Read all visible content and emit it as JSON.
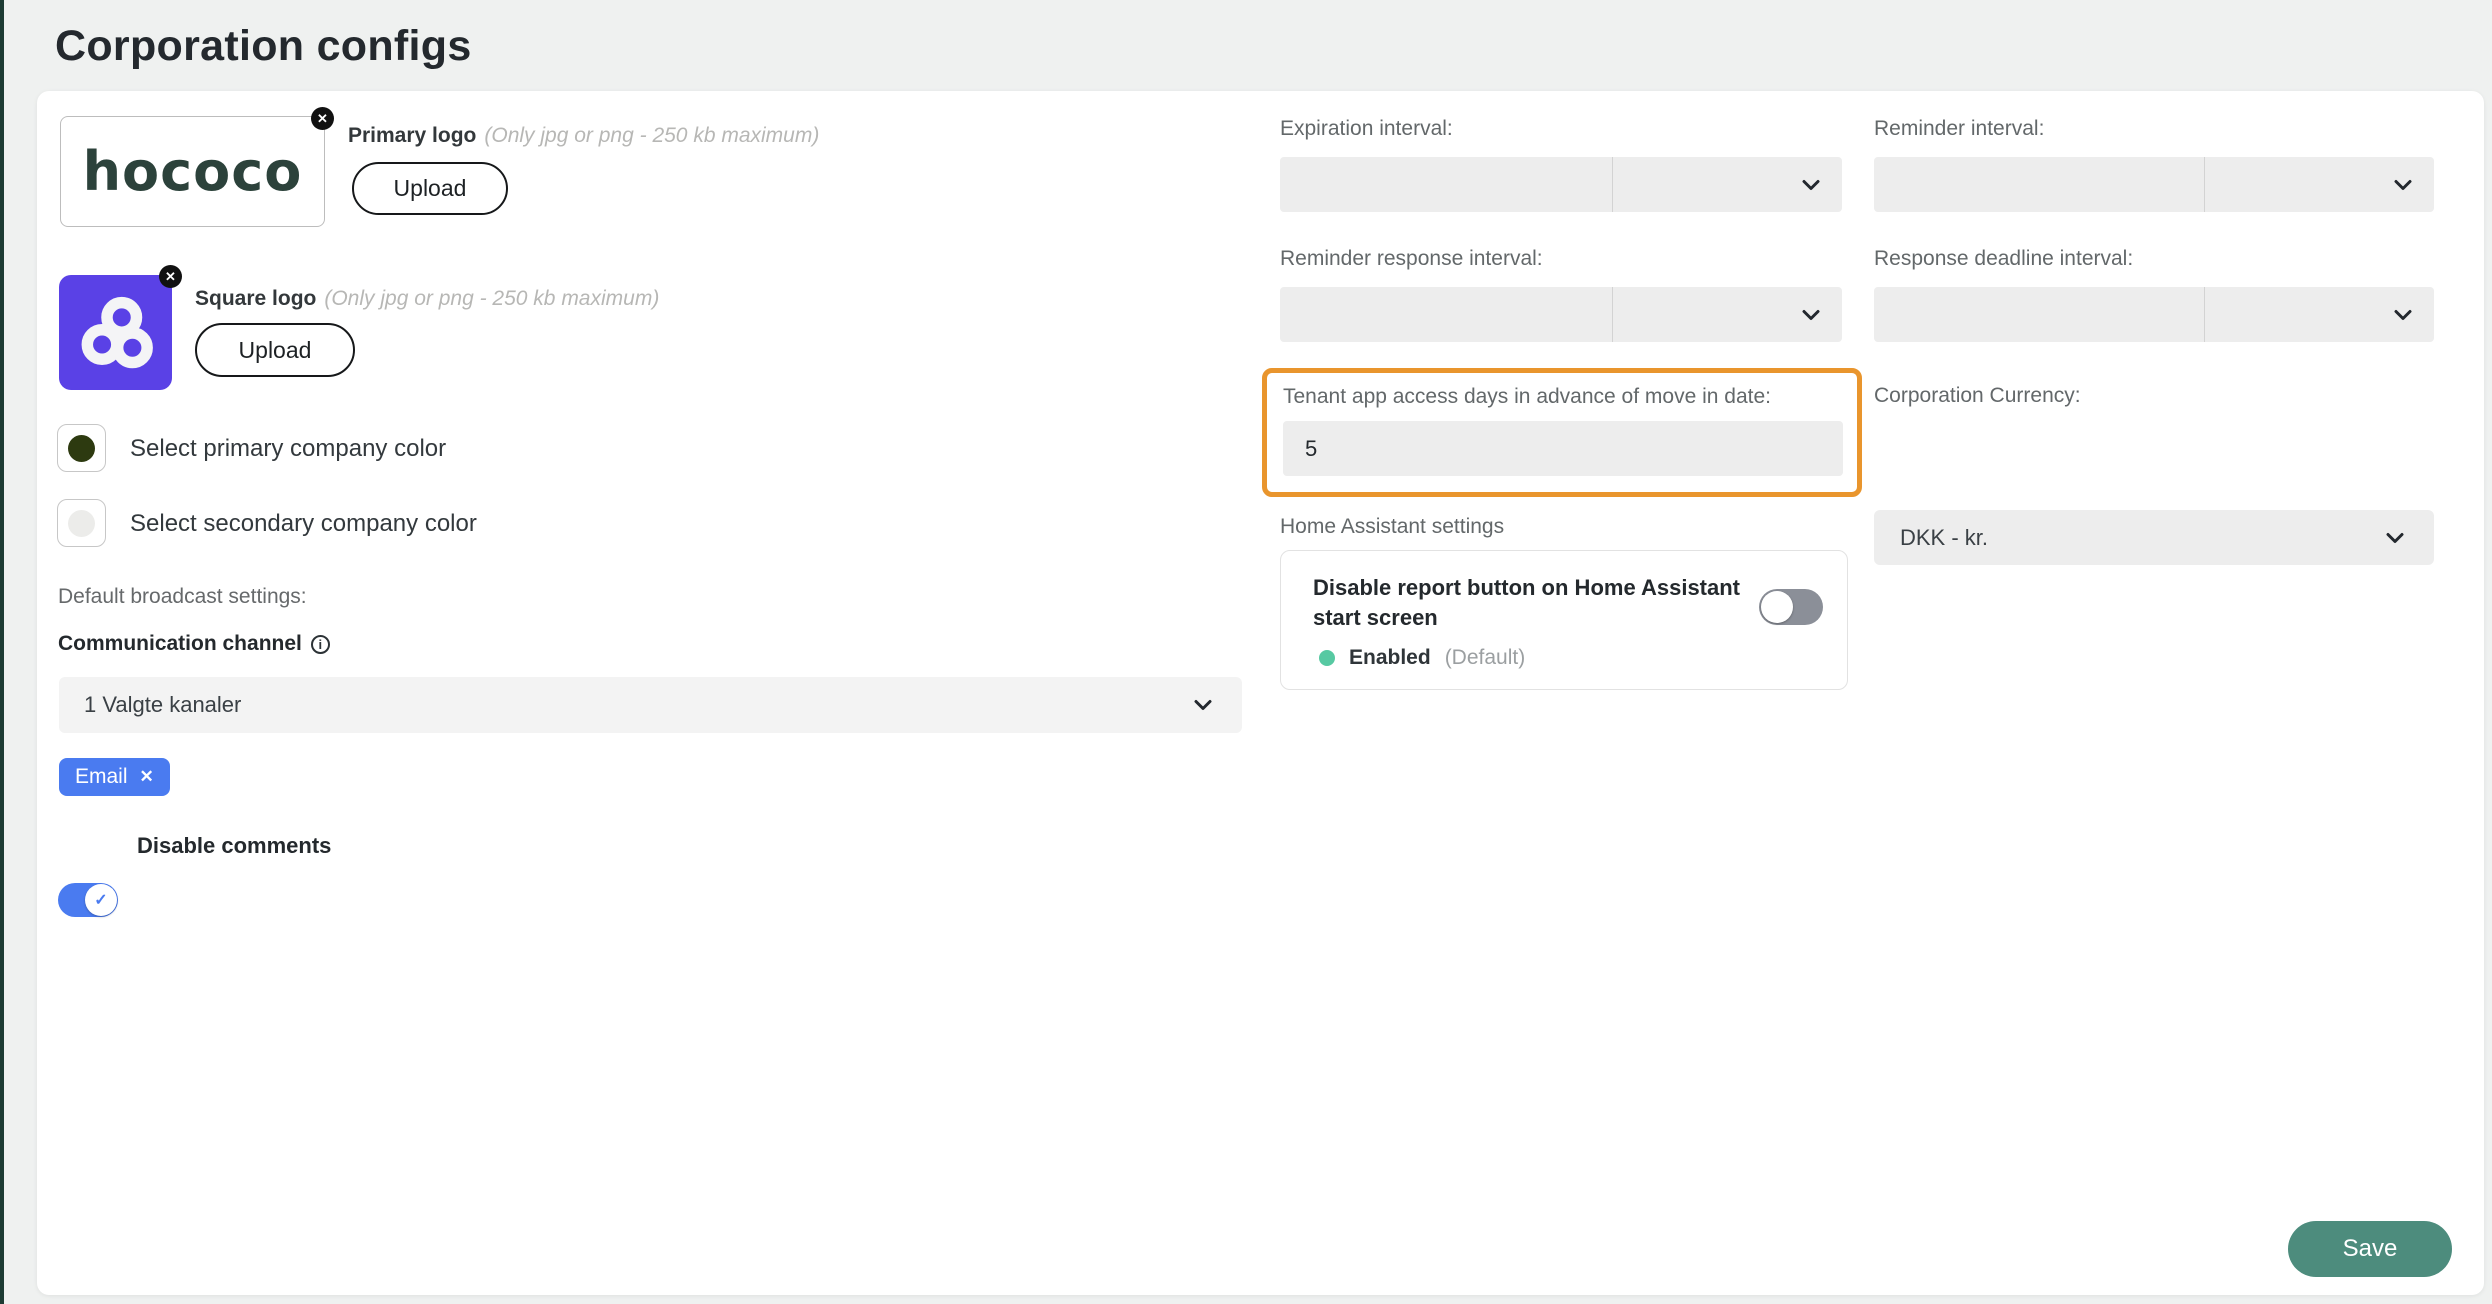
{
  "page": {
    "title": "Corporation configs"
  },
  "branding": {
    "primary_logo": {
      "label": "Primary logo",
      "note": "(Only jpg or png - 250 kb maximum)",
      "upload_label": "Upload",
      "wordmark": "hococo"
    },
    "square_logo": {
      "label": "Square logo",
      "note": "(Only jpg or png - 250 kb maximum)",
      "upload_label": "Upload"
    },
    "primary_color": {
      "label": "Select primary company color",
      "color": "#2d3a10"
    },
    "secondary_color": {
      "label": "Select secondary company color",
      "color": "#ececea"
    }
  },
  "broadcast": {
    "section_label": "Default broadcast settings:",
    "channel_label": "Communication channel",
    "channel_value": "1 Valgte kanaler",
    "tag": "Email",
    "tag_remove": "✕",
    "disable_comments_label": "Disable comments"
  },
  "intervals": {
    "expiration": {
      "label": "Expiration interval:",
      "value": ""
    },
    "reminder": {
      "label": "Reminder interval:",
      "value": ""
    },
    "reminder_response": {
      "label": "Reminder response interval:",
      "value": ""
    },
    "response_deadline": {
      "label": "Response deadline interval:",
      "value": ""
    }
  },
  "tenant_access": {
    "label": "Tenant app access days in advance of move in date:",
    "value": "5",
    "highlight_color": "#e9952d"
  },
  "currency": {
    "label": "Corporation Currency:",
    "value": "DKK - kr."
  },
  "home_assistant": {
    "section_label": "Home Assistant settings",
    "toggle_label": "Disable report button on Home Assistant start screen",
    "status": "Enabled",
    "status_suffix": "(Default)",
    "status_color": "#57c9a2"
  },
  "footer": {
    "save_label": "Save"
  },
  "colors": {
    "brand_purple": "#5a41e6",
    "accent_blue": "#4a7bf0",
    "save_teal": "#4d8c7d",
    "sidebar_strip": "#1d3b33"
  }
}
